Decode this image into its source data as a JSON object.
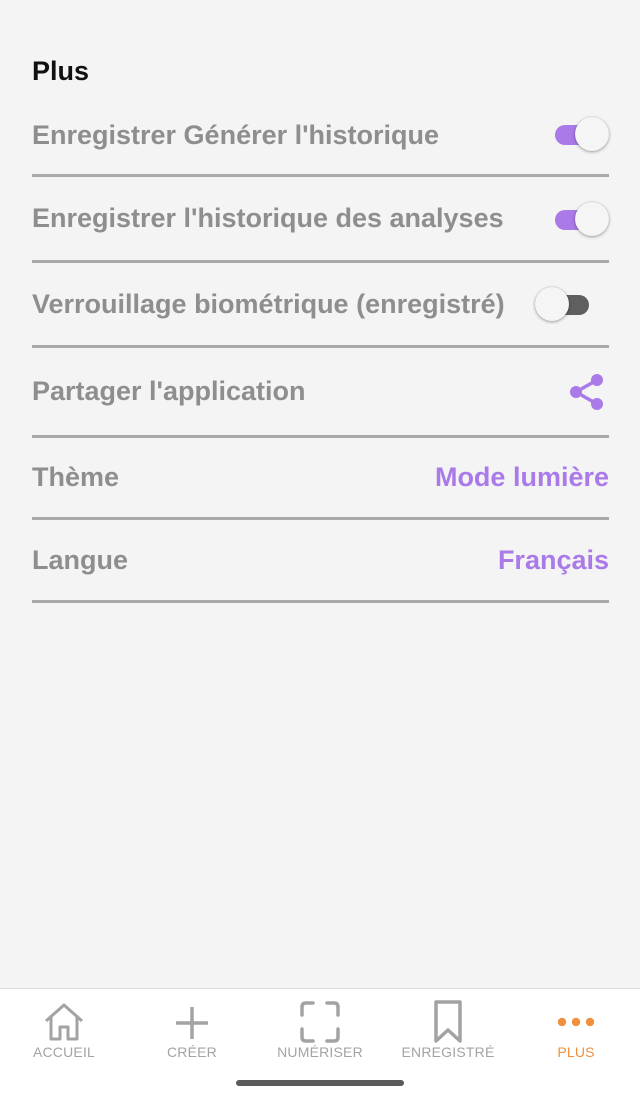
{
  "header": {
    "title": "Plus"
  },
  "settings": {
    "history_generate": {
      "label": "Enregistrer Générer l'historique",
      "enabled": true
    },
    "history_scan": {
      "label": "Enregistrer l'historique des analyses",
      "enabled": true
    },
    "biometric_lock": {
      "label": "Verrouillage biométrique (enregistré)",
      "enabled": false
    },
    "share_app": {
      "label": "Partager l'application",
      "icon": "share-icon"
    },
    "theme": {
      "label": "Thème",
      "value": "Mode lumière"
    },
    "language": {
      "label": "Langue",
      "value": "Français"
    }
  },
  "nav": {
    "items": [
      {
        "label": "ACCUEIL",
        "icon": "home-icon"
      },
      {
        "label": "CRÉER",
        "icon": "plus-icon"
      },
      {
        "label": "NUMÉRISER",
        "icon": "scan-icon"
      },
      {
        "label": "ENREGISTRÉ",
        "icon": "bookmark-icon"
      },
      {
        "label": "PLUS",
        "icon": "more-dots-icon"
      }
    ],
    "active": "PLUS"
  },
  "colors": {
    "accent": "#a97ae8",
    "nav_active": "#f0903c",
    "label_gray": "#8e8e8e",
    "divider": "#a9a9a9",
    "background": "#f4f4f4"
  }
}
